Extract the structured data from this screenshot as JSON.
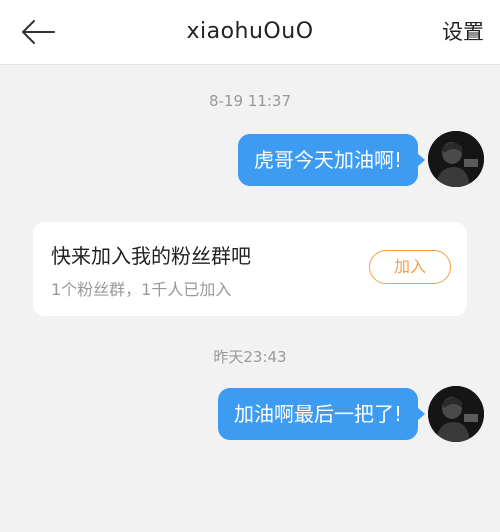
{
  "header": {
    "back_icon": "arrow-left-icon",
    "title": "xiaohuOuO",
    "settings_label": "设置"
  },
  "messages": [
    {
      "timestamp": "8-19 11:37",
      "text": "虎哥今天加油啊!"
    },
    {
      "timestamp": "昨天23:43",
      "text": "加油啊最后一把了!"
    }
  ],
  "group_card": {
    "title": "快来加入我的粉丝群吧",
    "subtitle": "1个粉丝群，1千人已加入",
    "join_label": "加入"
  },
  "colors": {
    "bubble": "#3d9cf2",
    "join_accent": "#f0a044",
    "background": "#f2f2f2"
  }
}
